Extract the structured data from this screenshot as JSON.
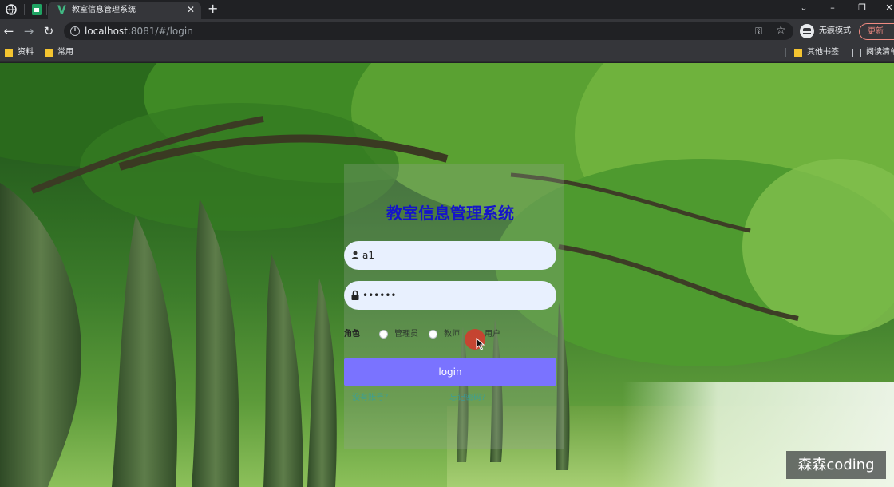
{
  "browser": {
    "tab_title": "教室信息管理系统",
    "url_host": "localhost",
    "url_rest": ":8081/#/login",
    "incognito_label": "无痕模式",
    "update_label": "更新",
    "bookmarks": [
      "资料",
      "常用"
    ],
    "bookmarks_right": [
      "其他书签",
      "阅读清单"
    ]
  },
  "login": {
    "title": "教室信息管理系统",
    "username_value": "a1",
    "password_value": "••••••",
    "role_label": "角色",
    "roles": [
      "管理员",
      "教师",
      "用户"
    ],
    "login_button": "login",
    "link_left": "没有账号？",
    "link_right": "忘记密码？"
  },
  "watermark": "森森coding",
  "colors": {
    "title": "#1515c9",
    "login_button": "#7a73ff",
    "input_bg": "#e8f0fe",
    "chrome_bg": "#35363a"
  }
}
